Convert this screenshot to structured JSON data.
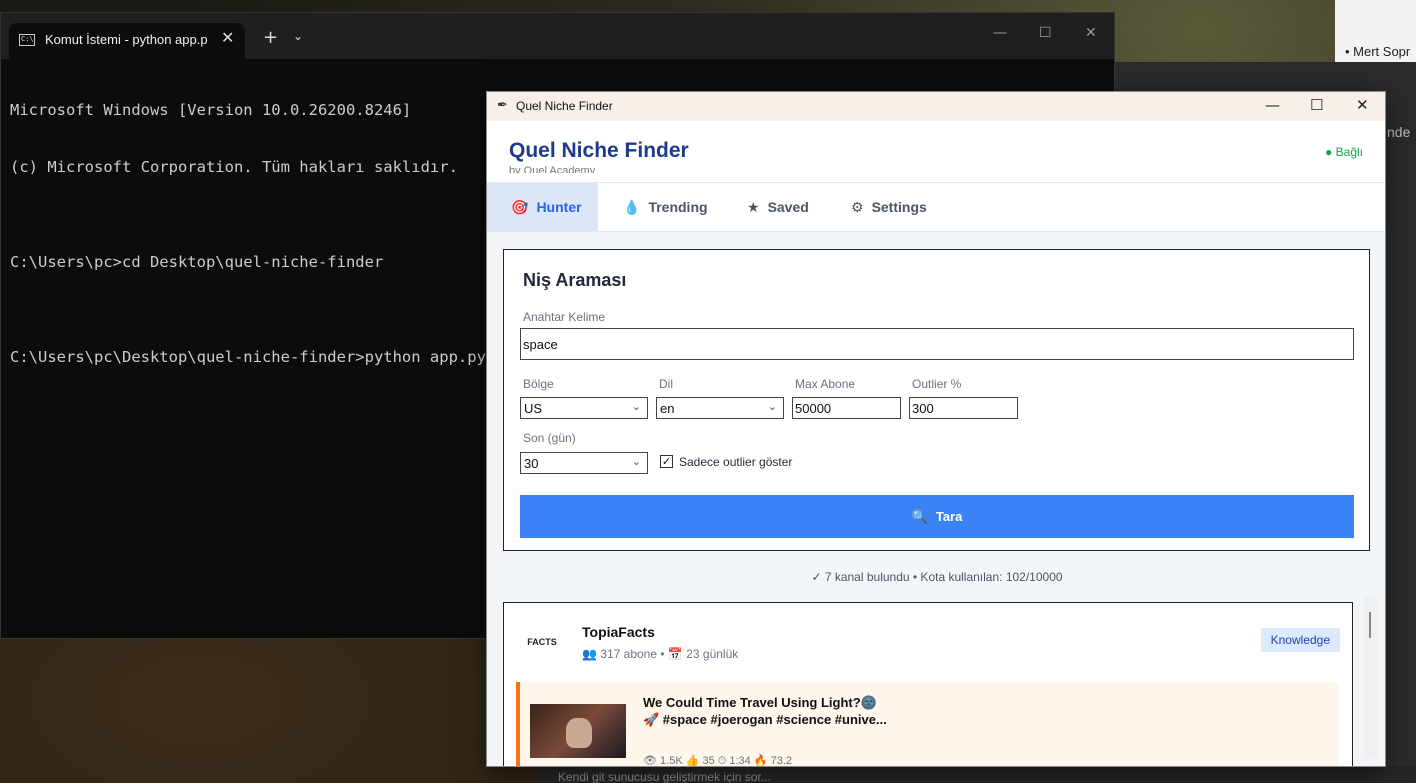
{
  "desktop": {
    "notification_item": "• Mert Sopr",
    "side_fragment": "nde",
    "bottom_fragment": "Kendi git sunucusu geliştirmek için sor..."
  },
  "terminal": {
    "tab_title": "Komut İstemi - python  app.p",
    "lines": [
      "Microsoft Windows [Version 10.0.26200.8246]",
      "(c) Microsoft Corporation. Tüm hakları saklıdır.",
      "",
      "C:\\Users\\pc>cd Desktop\\quel-niche-finder",
      "",
      "C:\\Users\\pc\\Desktop\\quel-niche-finder>python app.py"
    ]
  },
  "app": {
    "window_title": "Quel Niche Finder",
    "brand": "Quel Niche Finder",
    "subtitle": "by Quel Academy",
    "status": "● Bağlı",
    "tabs": [
      {
        "label": "Hunter",
        "icon": "🎯"
      },
      {
        "label": "Trending",
        "icon": "💧"
      },
      {
        "label": "Saved",
        "icon": "★"
      },
      {
        "label": "Settings",
        "icon": "⚙"
      }
    ],
    "form": {
      "heading": "Niş Araması",
      "keyword_label": "Anahtar Kelime",
      "keyword_value": "space",
      "region_label": "Bölge",
      "region_value": "US",
      "lang_label": "Dil",
      "lang_value": "en",
      "max_subs_label": "Max Abone",
      "max_subs_value": "50000",
      "outlier_label": "Outlier %",
      "outlier_value": "300",
      "days_label": "Son (gün)",
      "days_value": "30",
      "only_outliers_label": "Sadece outlier göster",
      "only_outliers_checked": true,
      "scan_label": "Tara"
    },
    "summary": "✓ 7 kanal bulundu  •  Kota kullanılan: 102/10000",
    "results": [
      {
        "channel_name": "TopiaFacts",
        "logo_text": "FACTS",
        "subscribers": "317 abone",
        "age": "23 günlük",
        "category": "Knowledge",
        "video": {
          "title": "We Could Time Travel Using Light?🌚🚀 #space #joerogan #science #unive...",
          "stats": "👁 1.5K   👍 35   ⏱ 1:34   🔥 73.2"
        }
      }
    ]
  }
}
